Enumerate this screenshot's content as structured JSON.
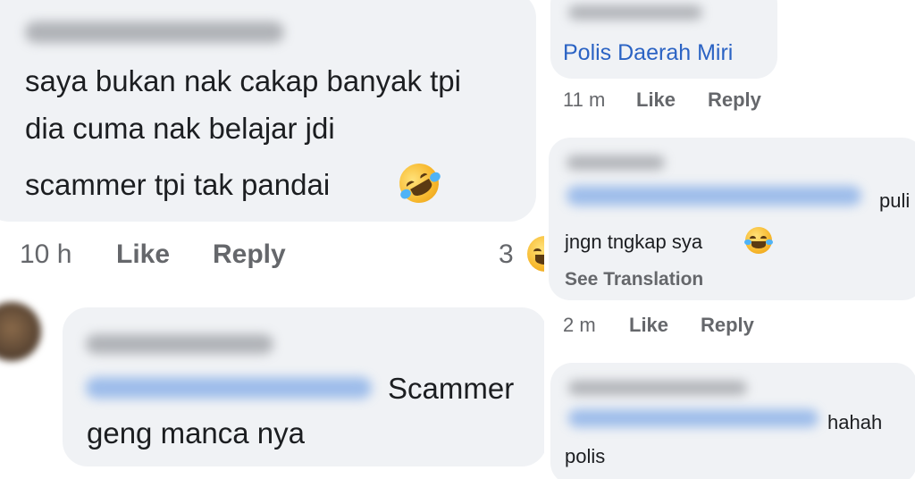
{
  "left": {
    "comment1": {
      "text_lines": [
        "saya bukan nak cakap banyak tpi",
        "dia cuma nak belajar jdi",
        "scammer tpi tak pandai"
      ],
      "emoji": "rolling-on-floor-laughing-emoji",
      "time": "10 h",
      "like": "Like",
      "reply": "Reply",
      "reaction_count": "3"
    },
    "comment2": {
      "text_suffix": "Scammer",
      "text_line2": "geng manca nya"
    }
  },
  "right": {
    "comment1": {
      "link": "Polis Daerah Miri",
      "time": "11 m",
      "like": "Like",
      "reply": "Reply"
    },
    "comment2": {
      "text_suffix": "puli",
      "text_line2": "jngn tngkap sya",
      "see_translation": "See Translation",
      "time": "2 m",
      "like": "Like",
      "reply": "Reply"
    },
    "comment3": {
      "text_suffix": "hahah",
      "text_line2": "polis"
    }
  },
  "colors": {
    "bubble": "#f0f2f5",
    "text": "#1c1e21",
    "meta": "#65676b",
    "link": "#2b63c4"
  }
}
